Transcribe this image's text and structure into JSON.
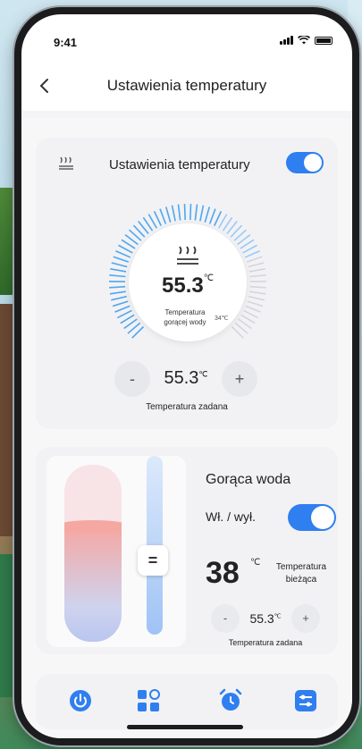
{
  "status_bar": {
    "time": "9:41"
  },
  "nav": {
    "title": "Ustawienia temperatury",
    "back_icon": "chevron-left-icon"
  },
  "temperature_card": {
    "title": "Ustawienia temperatury",
    "toggle_on": true,
    "dial": {
      "value": "55.3",
      "unit": "℃",
      "label": "Temperatura gorącej wody",
      "small_value": "34℃"
    },
    "setpoint": {
      "value": "55.3",
      "unit": "℃",
      "minus": "-",
      "plus": "+",
      "label": "Temperatura zadana"
    }
  },
  "hot_water_card": {
    "title": "Gorąca woda",
    "onoff_label": "Wł. / wył.",
    "toggle_on": true,
    "current_temp": "38",
    "current_unit": "℃",
    "current_label": "Temperatura bieżąca",
    "setpoint": {
      "value": "55.3",
      "unit": "℃",
      "minus": "-",
      "plus": "+",
      "label": "Temperatura zadana"
    },
    "slider_handle": "="
  },
  "tabbar": {
    "items": [
      "power-icon",
      "grid-icon",
      "alarm-clock-icon",
      "sliders-icon"
    ]
  },
  "colors": {
    "accent": "#2f7ff0",
    "card_bg": "#f2f2f4"
  }
}
